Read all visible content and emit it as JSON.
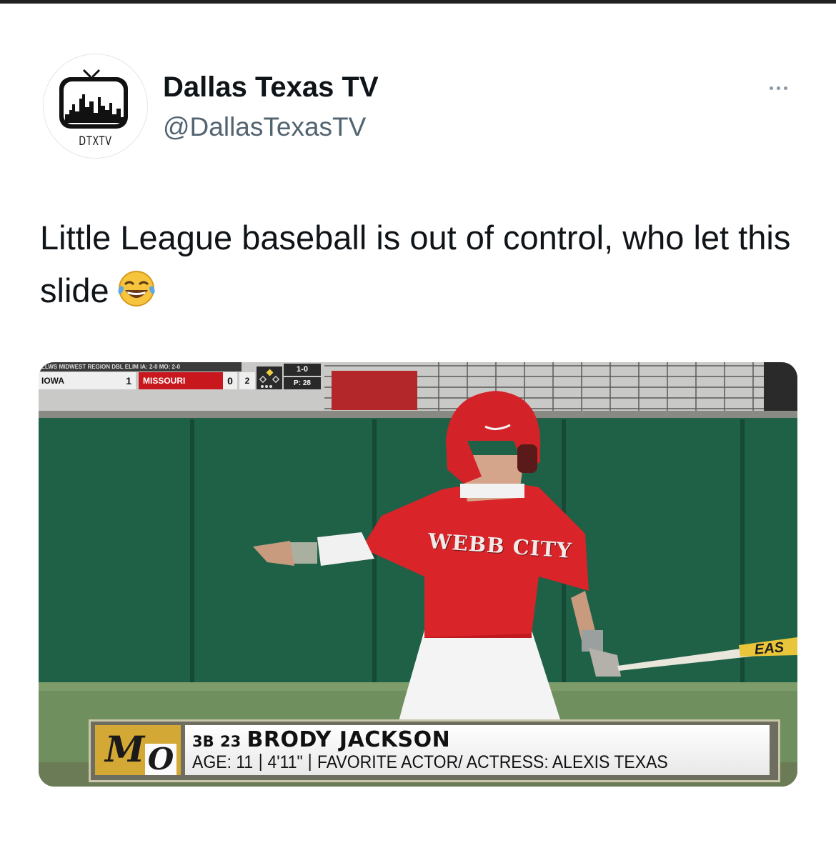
{
  "tweet": {
    "author": {
      "display_name": "Dallas Texas TV",
      "handle": "@DallasTexasTV",
      "avatar_logo_text": "DTXTV",
      "avatar_icon": "tv-skyline-logo"
    },
    "more_icon": "more-options-icon",
    "text": "Little League baseball is out of control, who let this slide",
    "emoji": "face-with-tears-of-joy"
  },
  "media": {
    "jersey_text": "WEBB CITY",
    "bat_text": "EAS",
    "scorebug": {
      "region_text": "LLWS MIDWEST REGION DBL ELIM IA: 2-0 MO: 2-0",
      "away_team": "IOWA",
      "away_score": "1",
      "home_team": "MISSOURI",
      "home_score": "0",
      "inning": "2",
      "count": "1-0",
      "pitch_count": "P: 28",
      "home_color": "#c8181e"
    },
    "lower_third": {
      "logo_letter_1": "M",
      "logo_letter_2": "O",
      "position": "3B",
      "number": "23",
      "player_name": "BRODY JACKSON",
      "age": "AGE: 11",
      "height": "4'11\"",
      "favorite": "FAVORITE ACTOR/ ACTRESS: ALEXIS TEXAS",
      "logo_color": "#d4a834"
    }
  }
}
